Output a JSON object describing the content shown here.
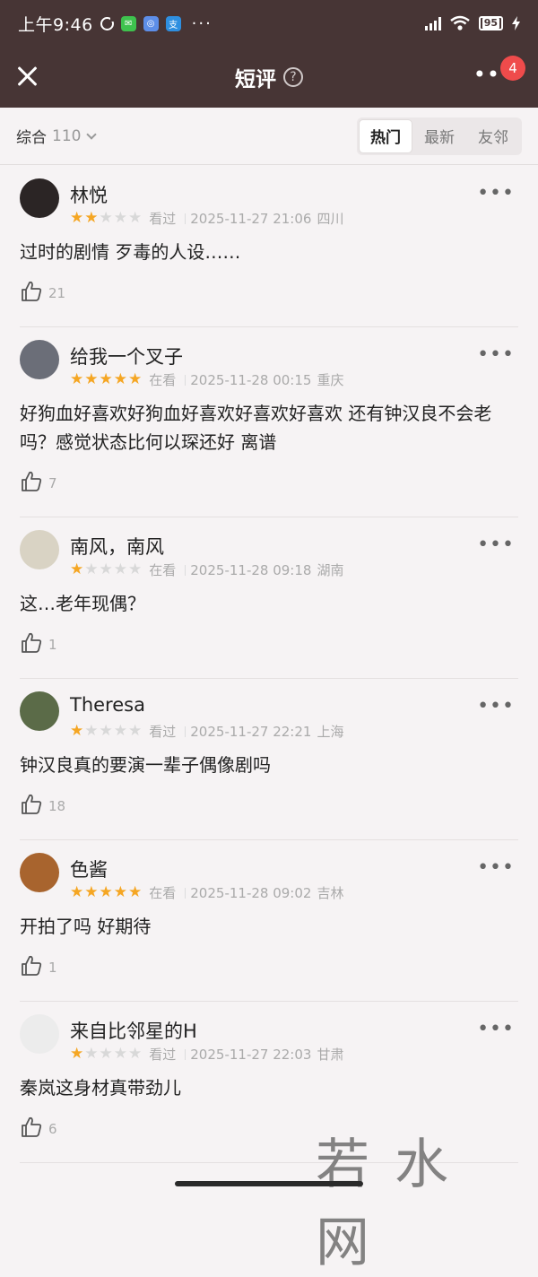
{
  "status_bar": {
    "time": "上午9:46",
    "battery": "95",
    "more": "···"
  },
  "header": {
    "title": "短评",
    "help_symbol": "?",
    "badge": "4",
    "more": "••"
  },
  "filter": {
    "sort_label": "综合",
    "sort_count": "110",
    "tabs": [
      {
        "label": "热门",
        "active": true
      },
      {
        "label": "最新",
        "active": false
      },
      {
        "label": "友邻",
        "active": false
      }
    ]
  },
  "reviews": [
    {
      "username": "林悦",
      "rating": 2,
      "status": "看过",
      "datetime": "2025-11-27 21:06",
      "location": "四川",
      "content": "过时的剧情 歹毒的人设……",
      "likes": "21",
      "avatar_color": "#2b2525"
    },
    {
      "username": "给我一个叉子",
      "rating": 5,
      "status": "在看",
      "datetime": "2025-11-28 00:15",
      "location": "重庆",
      "content": "好狗血好喜欢好狗血好喜欢好喜欢好喜欢 还有钟汉良不会老吗？感觉状态比何以琛还好 离谱",
      "likes": "7",
      "avatar_color": "#6b6e78"
    },
    {
      "username": "南风，南风",
      "rating": 1,
      "status": "在看",
      "datetime": "2025-11-28 09:18",
      "location": "湖南",
      "content": "这…老年现偶？",
      "likes": "1",
      "avatar_color": "#d9d3c4"
    },
    {
      "username": "Theresa",
      "rating": 1,
      "status": "看过",
      "datetime": "2025-11-27 22:21",
      "location": "上海",
      "content": "钟汉良真的要演一辈子偶像剧吗",
      "likes": "18",
      "avatar_color": "#5b6b48"
    },
    {
      "username": "色酱",
      "rating": 5,
      "status": "在看",
      "datetime": "2025-11-28 09:02",
      "location": "吉林",
      "content": "开拍了吗 好期待",
      "likes": "1",
      "avatar_color": "#a8642e"
    },
    {
      "username": "来自比邻星的H",
      "rating": 1,
      "status": "看过",
      "datetime": "2025-11-27 22:03",
      "location": "甘肃",
      "content": "秦岚这身材真带劲儿",
      "likes": "6",
      "avatar_color": "#ececec"
    }
  ],
  "watermark": "若水网"
}
